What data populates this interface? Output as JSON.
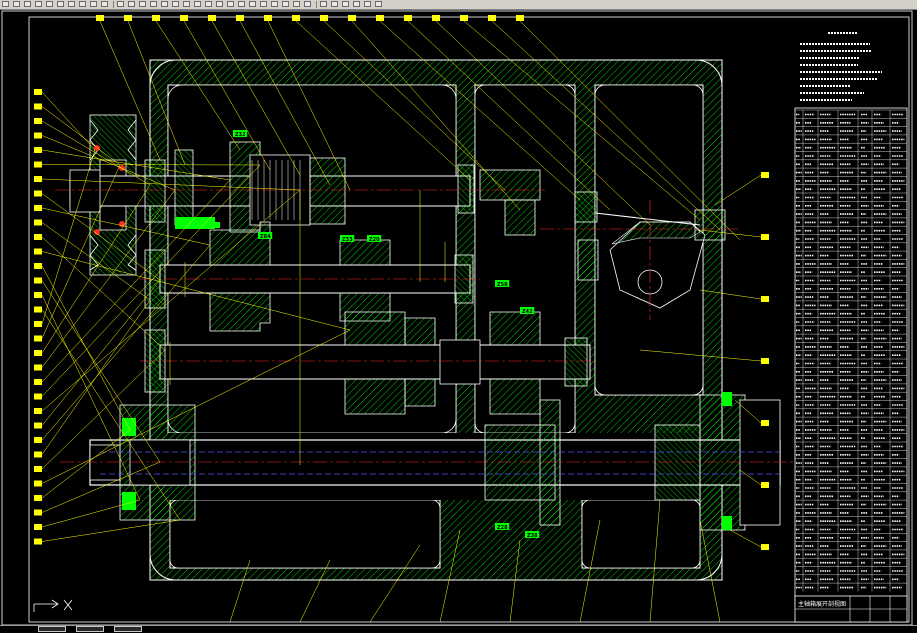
{
  "toolbar": {
    "buttons": 34,
    "separators": [
      10,
      28,
      52,
      78
    ]
  },
  "layout_tabs": [
    "Model",
    "Layout1",
    "Layout2"
  ],
  "drawing": {
    "gear_labels": [
      "Z32",
      "Z84",
      "Z33",
      "Z20",
      "Z58",
      "Z42",
      "Z28",
      "Z38"
    ],
    "bubble_count_left": 32,
    "bubble_count_top": 16,
    "bubble_count_right": 7
  },
  "parts_list": {
    "row_count": 58
  },
  "title_block": {
    "name": "主轴箱展开剖视图"
  },
  "colors": {
    "frame": "#ffffff",
    "hatch": "#00ff00",
    "leader": "#ffff00",
    "bubble": "#ffff00",
    "centerline": "#ff2a2a",
    "dimension": "#5050ff",
    "part_green": "#00ff00"
  }
}
